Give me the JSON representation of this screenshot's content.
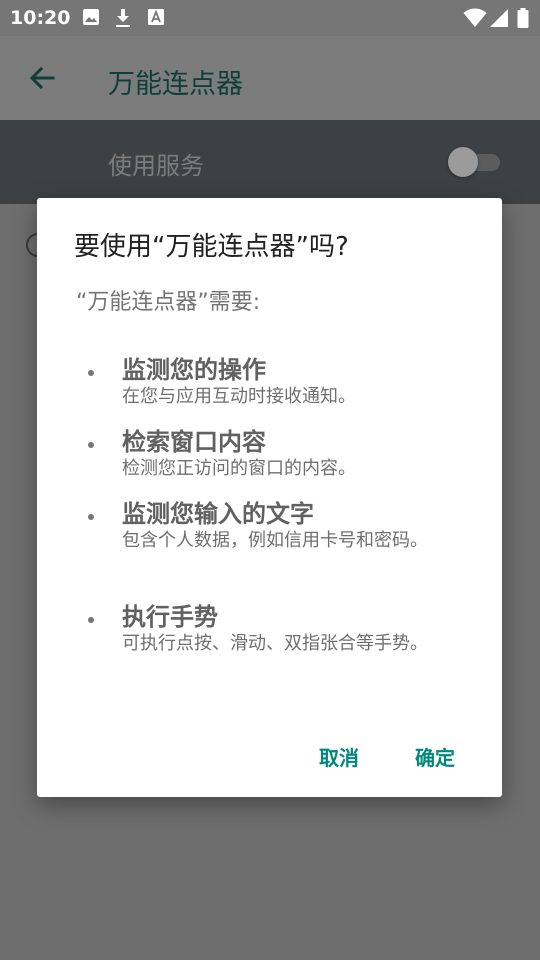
{
  "status_bar": {
    "time": "10:20",
    "icons": [
      "image-icon",
      "download-icon",
      "text-a-icon",
      "wifi-icon",
      "signal-icon",
      "battery-icon"
    ]
  },
  "app_bar": {
    "title": "万能连点器"
  },
  "service": {
    "label": "使用服务",
    "enabled": false
  },
  "dialog": {
    "title": "要使用“万能连点器”吗?",
    "intro": "“万能连点器”需要:",
    "permissions": [
      {
        "title": "监测您的操作",
        "desc": "在您与应用互动时接收通知。"
      },
      {
        "title": "检索窗口内容",
        "desc": "检测您正访问的窗口的内容。"
      },
      {
        "title": "监测您输入的文字",
        "desc": "包含个人数据，例如信用卡号和密码。"
      },
      {
        "title": "执行手势",
        "desc": "可执行点按、滑动、双指张合等手势。"
      }
    ],
    "cancel_label": "取消",
    "ok_label": "确定"
  },
  "colors": {
    "accent": "#00897b",
    "scrim": "#6e6e6e",
    "dialog_bg": "#ffffff"
  }
}
